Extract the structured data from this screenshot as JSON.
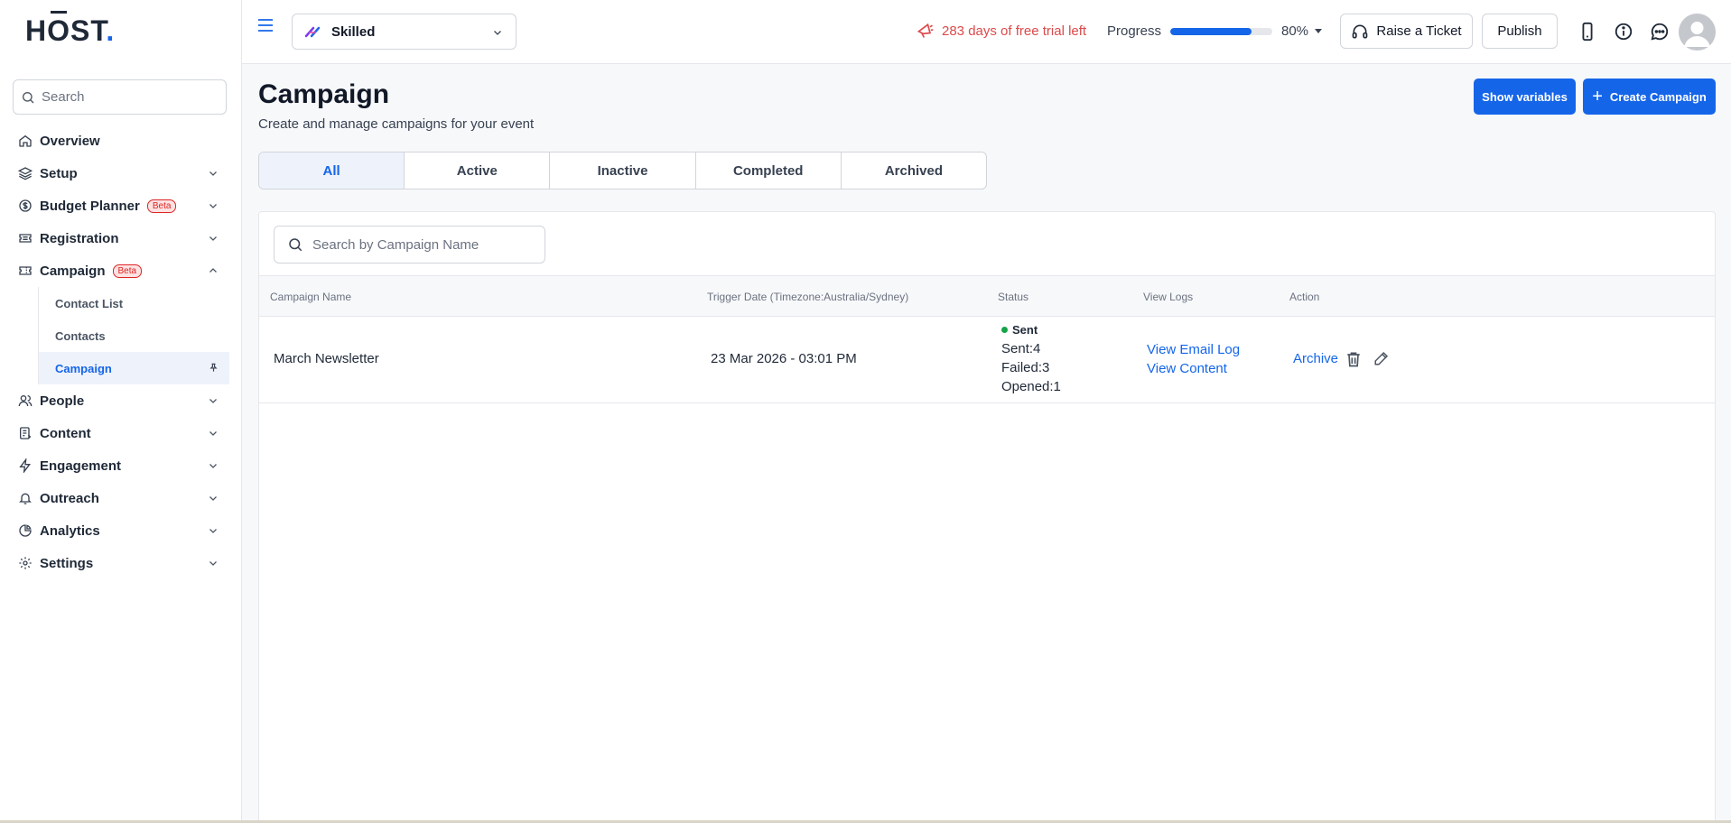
{
  "logo": {
    "text_h": "H",
    "text_o": "O",
    "text_rest": "ST",
    "text_dot": "."
  },
  "sidebar": {
    "search_placeholder": "Search",
    "items": [
      {
        "label": "Overview",
        "icon": "home-icon"
      },
      {
        "label": "Setup",
        "icon": "layers-icon"
      },
      {
        "label": "Budget Planner",
        "icon": "dollar-icon",
        "badge": "Beta"
      },
      {
        "label": "Registration",
        "icon": "ticket-icon"
      },
      {
        "label": "Campaign",
        "icon": "campaign-ticket-icon",
        "badge": "Beta",
        "expanded": true,
        "children": [
          {
            "label": "Contact List"
          },
          {
            "label": "Contacts"
          },
          {
            "label": "Campaign",
            "active": true
          }
        ]
      },
      {
        "label": "People",
        "icon": "people-icon"
      },
      {
        "label": "Content",
        "icon": "content-icon"
      },
      {
        "label": "Engagement",
        "icon": "bolt-icon"
      },
      {
        "label": "Outreach",
        "icon": "bell-icon"
      },
      {
        "label": "Analytics",
        "icon": "pie-icon"
      },
      {
        "label": "Settings",
        "icon": "gear-icon"
      }
    ]
  },
  "topbar": {
    "event_name": "Skilled",
    "trial_text": "283 days of free trial left",
    "progress_label": "Progress",
    "progress_value": "80%",
    "progress_fraction": 0.8,
    "ticket_label": "Raise a Ticket",
    "publish_label": "Publish"
  },
  "main": {
    "title": "Campaign",
    "subtitle": "Create and manage campaigns for your event",
    "show_variables_label": "Show variables",
    "create_campaign_label": "Create Campaign",
    "tabs": [
      {
        "label": "All",
        "active": true
      },
      {
        "label": "Active"
      },
      {
        "label": "Inactive"
      },
      {
        "label": "Completed"
      },
      {
        "label": "Archived"
      }
    ],
    "table": {
      "search_placeholder": "Search by Campaign Name",
      "columns": [
        "Campaign Name",
        "Trigger Date (Timezone:Australia/Sydney)",
        "Status",
        "View Logs",
        "Action"
      ],
      "rows": [
        {
          "name": "March Newsletter",
          "trigger_date": "23 Mar 2026 - 03:01 PM",
          "status": "Sent",
          "sent": "Sent:4",
          "failed": "Failed:3",
          "opened": "Opened:1",
          "view_email_log": "View Email Log",
          "view_content": "View Content",
          "archive": "Archive"
        }
      ]
    }
  },
  "colors": {
    "accent": "#1565e9",
    "trial": "#dc4a4a",
    "status_sent": "#16a34a",
    "beta": "#dc2626"
  }
}
